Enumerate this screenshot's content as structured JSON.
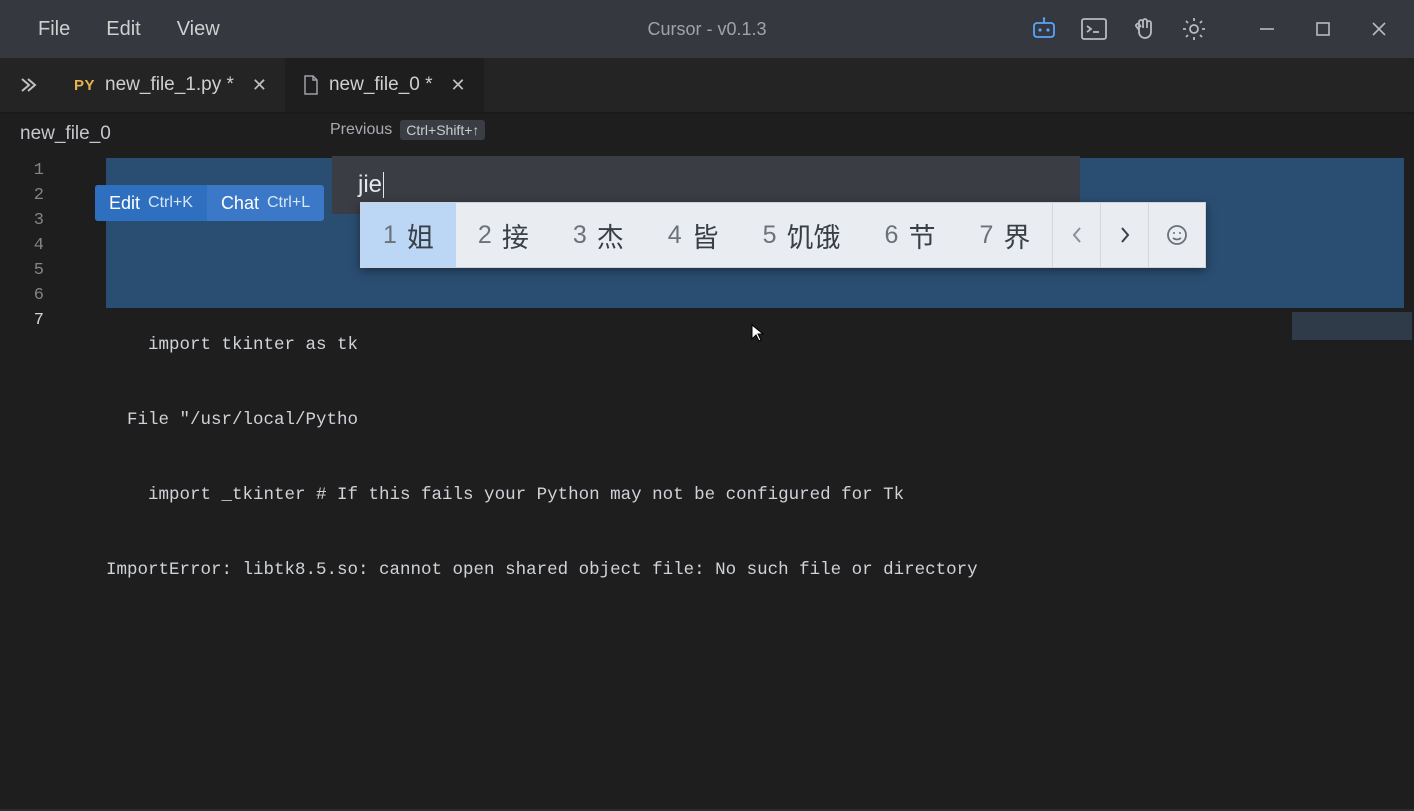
{
  "titlebar": {
    "menus": [
      "File",
      "Edit",
      "View"
    ],
    "title": "Cursor - v0.1.3"
  },
  "tabs": [
    {
      "icon": "py",
      "label": "new_file_1.py *",
      "active": false
    },
    {
      "icon": "file",
      "label": "new_file_0 *",
      "active": true
    }
  ],
  "breadcrumb": "new_file_0",
  "previous": {
    "label": "Previous",
    "shortcut": "Ctrl+Shift+↑"
  },
  "gutter": {
    "lines": [
      "1",
      "2",
      "3",
      "4",
      "5",
      "6",
      "7"
    ],
    "current": 7
  },
  "code": {
    "lines": [
      "",
      "",
      "    import tkinter as tk",
      "  File \"/usr/local/Pytho",
      "    import _tkinter # If this fails your Python may not be configured for Tk",
      "ImportError: libtk8.5.so: cannot open shared object file: No such file or directory",
      ""
    ]
  },
  "inline_popup": {
    "edit_label": "Edit",
    "edit_shortcut": "Ctrl+K",
    "chat_label": "Chat",
    "chat_shortcut": "Ctrl+L"
  },
  "ime": {
    "input": "jie",
    "candidates": [
      {
        "n": "1",
        "t": "姐"
      },
      {
        "n": "2",
        "t": "接"
      },
      {
        "n": "3",
        "t": "杰"
      },
      {
        "n": "4",
        "t": "皆"
      },
      {
        "n": "5",
        "t": "饥饿"
      },
      {
        "n": "6",
        "t": "节"
      },
      {
        "n": "7",
        "t": "界"
      }
    ],
    "selected_index": 0
  }
}
